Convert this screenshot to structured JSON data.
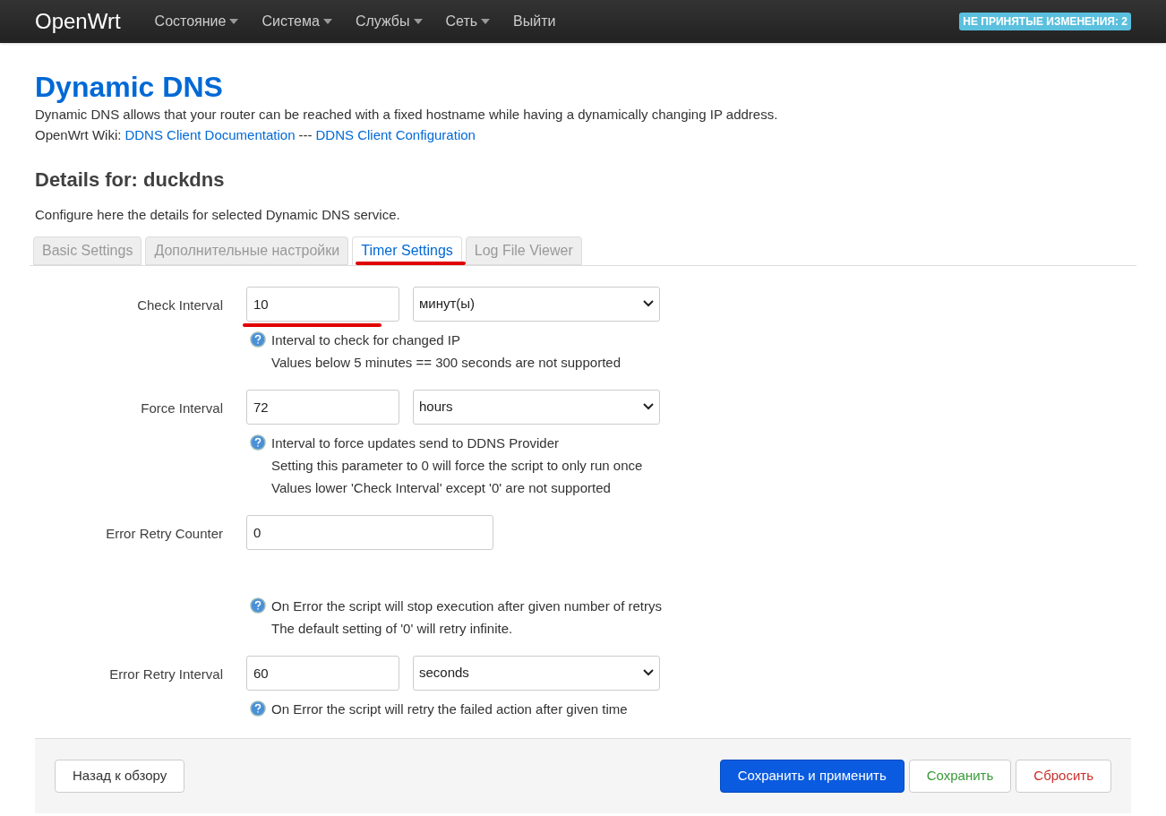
{
  "navbar": {
    "brand": "OpenWrt",
    "menu": [
      {
        "label": "Состояние",
        "dropdown": true
      },
      {
        "label": "Система",
        "dropdown": true
      },
      {
        "label": "Службы",
        "dropdown": true
      },
      {
        "label": "Сеть",
        "dropdown": true
      },
      {
        "label": "Выйти",
        "dropdown": false
      }
    ],
    "badge": "НЕ ПРИНЯТЫЕ ИЗМЕНЕНИЯ: 2"
  },
  "page": {
    "title": "Dynamic DNS",
    "description": "Dynamic DNS allows that your router can be reached with a fixed hostname while having a dynamically changing IP address.",
    "wiki_label": "OpenWrt Wiki:",
    "links": [
      "DDNS Client Documentation",
      "DDNS Client Configuration"
    ],
    "link_separator": "---"
  },
  "section": {
    "title": "Details for: duckdns",
    "description": "Configure here the details for selected Dynamic DNS service."
  },
  "tabs": [
    {
      "label": "Basic Settings",
      "selected": false,
      "annotated": false
    },
    {
      "label": "Дополнительные настройки",
      "selected": false,
      "annotated": false
    },
    {
      "label": "Timer Settings",
      "selected": true,
      "annotated": true
    },
    {
      "label": "Log File Viewer",
      "selected": false,
      "annotated": false
    }
  ],
  "fields": [
    {
      "label": "Check Interval",
      "value": "10",
      "unit": "минут(ы)",
      "annotated": true,
      "help": [
        "Interval to check for changed IP",
        "Values below 5 minutes == 300 seconds are not supported"
      ]
    },
    {
      "label": "Force Interval",
      "value": "72",
      "unit": "hours",
      "annotated": false,
      "help": [
        "Interval to force updates send to DDNS Provider",
        "Setting this parameter to 0 will force the script to only run once",
        "Values lower 'Check Interval' except '0' are not supported"
      ]
    },
    {
      "label": "Error Retry Counter",
      "value": "0",
      "annotated": false,
      "help": [
        "On Error the script will stop execution after given number of retrys",
        "The default setting of '0' will retry infinite."
      ]
    },
    {
      "label": "Error Retry Interval",
      "value": "60",
      "unit": "seconds",
      "annotated": false,
      "help": [
        "On Error the script will retry the failed action after given time"
      ]
    }
  ],
  "footer": {
    "back": "Назад к обзору",
    "save_apply": "Сохранить и применить",
    "save": "Сохранить",
    "reset": "Сбросить"
  }
}
